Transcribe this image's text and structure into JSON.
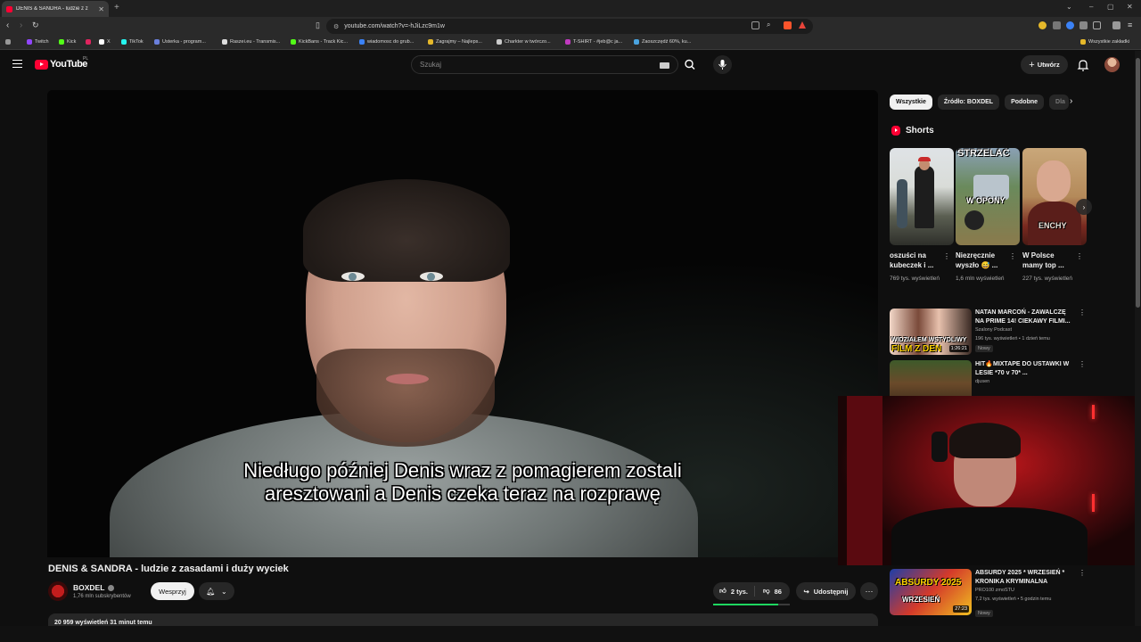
{
  "browser": {
    "tab_title": "DENIS & SANDRA - ludzie z z",
    "url": "youtube.com/watch?v=-hJiLzc9m1w",
    "bookmarks": [
      "Twitch",
      "Kick",
      "X",
      "TikTok",
      "Usterka - program...",
      "Raszei.eu - Transmis...",
      "KickBans - Track Kic...",
      "wiadomosc do grub...",
      "Zagrajmy – Najleps...",
      "Charkter w twórczo...",
      "T-SHIRT - #jeb@c ja...",
      "Zaoszczędź 60%, ku..."
    ],
    "all_bookmarks": "Wszystkie zakładki"
  },
  "header": {
    "logo_text": "YouTube",
    "region": "PL",
    "search_placeholder": "Szukaj",
    "create_label": "Utwórz"
  },
  "player": {
    "subtitle": "Niedługo później Denis wraz z pomagierem zostali aresztowani a Denis czeka teraz na rozprawę"
  },
  "video": {
    "title": "DENIS & SANDRA - ludzie z zasadami i duży wyciek",
    "channel": "BOXDEL",
    "subscribers": "1,76 mln subskrybentów",
    "support_label": "Wesprzyj",
    "likes": "2 tys.",
    "dislikes": "86",
    "like_ratio": 0.85,
    "share_label": "Udostępnij",
    "views_line": "20 959 wyświetleń  31 minut temu"
  },
  "sidebar": {
    "chips": [
      "Wszystkie",
      "Źródło: BOXDEL",
      "Podobne",
      "Dla"
    ],
    "shorts_heading": "Shorts",
    "shorts": [
      {
        "title": "oszuści na kubeczek i ...",
        "views": "769 tys. wyświetleń",
        "overlay": ""
      },
      {
        "title": "Niezręcznie wyszło 😅 ...",
        "views": "1,6 mln wyświetleń",
        "overlay_top": "STRZELAĆ",
        "overlay_bottom": "W OPONY"
      },
      {
        "title": "W Polsce mamy top ...",
        "views": "227 tys. wyświetleń",
        "overlay": "ENCHY"
      }
    ],
    "videos": [
      {
        "title": "NATAN MARCOŃ - ZAWALCZĘ NA PRIME 14! CIEKAWY FILMI...",
        "channel": "Szalony Podcast",
        "meta": "196 tys. wyświetleń • 1 dzień temu",
        "badge": "Nowy",
        "duration": "1:26:21",
        "thumb_text_1": "WIDZIAŁEM WSTYDLIWY",
        "thumb_text_2": "FILM Z DEN"
      },
      {
        "title": "HIT🔥MIXTAPE DO USTAWKI W LESIE *70 v 70* ...",
        "channel": "djusen",
        "meta": "",
        "badge": "",
        "duration": "",
        "thumb_text_1": "",
        "thumb_text_2": ""
      },
      {
        "title": "ABSURDY 2025 * WRZESIEŃ * KRONIKA KRYMINALNA",
        "channel": "PRO100 zmoSTU",
        "meta": "7,2 tys. wyświetleń • 5 godzin temu",
        "badge": "Nowy",
        "duration": "27:23",
        "thumb_text_1": "ABSURDY 2025",
        "thumb_text_2": "WRZESIEŃ"
      }
    ]
  }
}
